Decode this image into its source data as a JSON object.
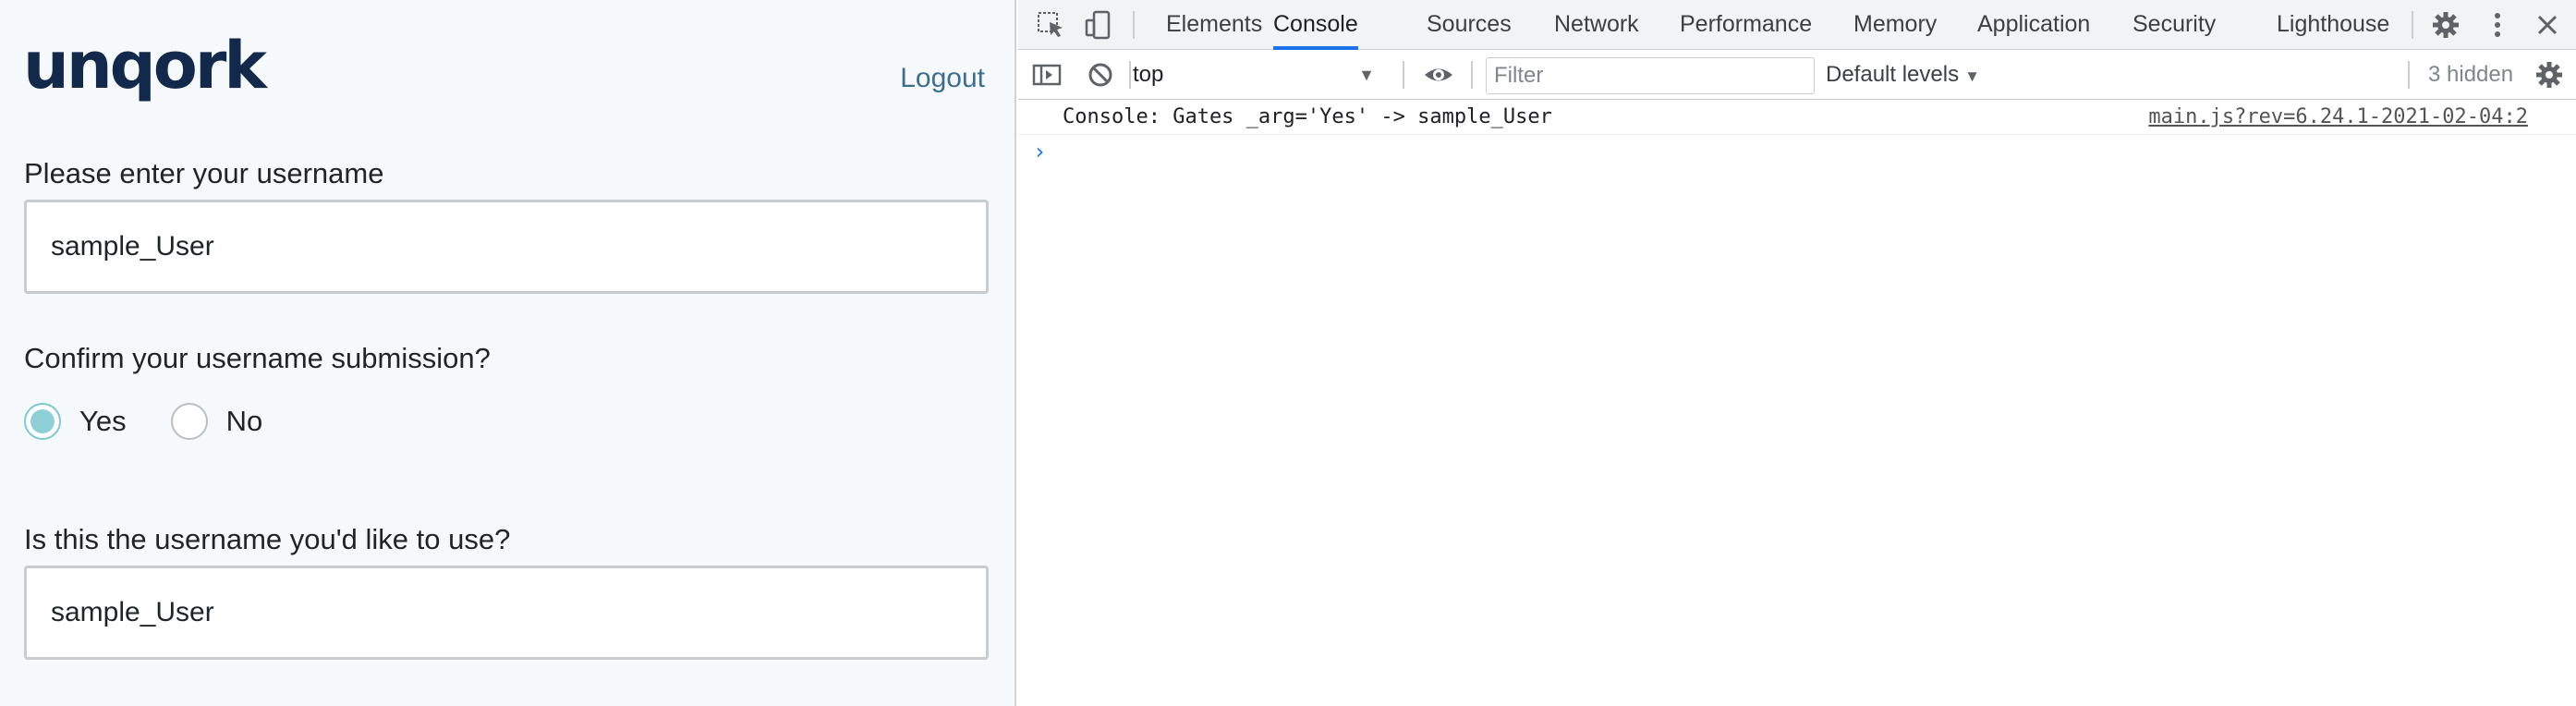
{
  "app": {
    "logo_text": "unqork",
    "logout_label": "Logout",
    "username_label": "Please enter your username",
    "username_value": "sample_User",
    "confirm_label": "Confirm your username submission?",
    "radio_options": [
      {
        "label": "Yes",
        "checked": true
      },
      {
        "label": "No",
        "checked": false
      }
    ],
    "confirm_username_label": "Is this the username you'd like to use?",
    "confirm_username_value": "sample_User"
  },
  "devtools": {
    "tabs": [
      {
        "label": "Elements",
        "active": false
      },
      {
        "label": "Console",
        "active": true
      },
      {
        "label": "Sources",
        "active": false
      },
      {
        "label": "Network",
        "active": false
      },
      {
        "label": "Performance",
        "active": false
      },
      {
        "label": "Memory",
        "active": false
      },
      {
        "label": "Application",
        "active": false
      },
      {
        "label": "Security",
        "active": false
      },
      {
        "label": "Lighthouse",
        "active": false
      }
    ],
    "toolbar": {
      "context": "top",
      "filter_placeholder": "Filter",
      "levels_label": "Default levels",
      "hidden_count": "3 hidden"
    },
    "console": {
      "messages": [
        {
          "text": "Console: Gates _arg='Yes' -> sample_User",
          "source": "main.js?rev=6.24.1-2021-02-04:2"
        }
      ],
      "prompt_symbol": "›"
    },
    "icons": {
      "inspect": "inspect-element-icon",
      "device": "device-toolbar-icon",
      "settings": "gear-icon",
      "more": "kebab-menu-icon",
      "close": "close-icon",
      "sidebar": "sidebar-toggle-icon",
      "clear": "clear-console-icon",
      "live_expression": "eye-icon"
    },
    "colors": {
      "accent": "#1a73e8",
      "radio_selected": "#8fd0d6",
      "logo": "#13294b",
      "link": "#3c6e8f"
    }
  }
}
